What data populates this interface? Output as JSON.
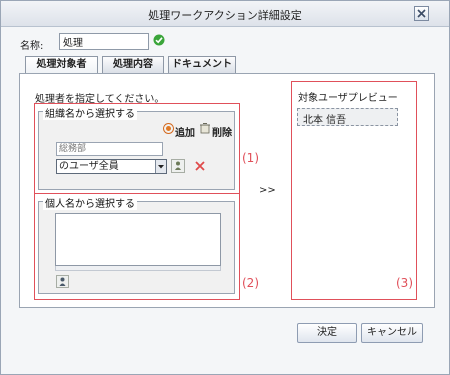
{
  "dialog": {
    "title": "処理ワークアクション詳細設定"
  },
  "name_field": {
    "label": "名称:",
    "value": "処理"
  },
  "tabs": [
    {
      "label": "処理対象者",
      "active": true
    },
    {
      "label": "処理内容",
      "active": false
    },
    {
      "label": "ドキュメント",
      "active": false
    }
  ],
  "main": {
    "instruction": "処理者を指定してください。",
    "org_section": {
      "legend": "組織名から選択する",
      "add_label": "追加",
      "delete_label": "削除",
      "dept_placeholder": "総務部",
      "selected_user": "のユーザ全員"
    },
    "person_section": {
      "legend": "個人名から選択する"
    },
    "transfer_arrow": ">>",
    "preview": {
      "title": "対象ユーザプレビュー",
      "users": [
        "北本 信吾"
      ]
    },
    "markers": [
      "(1)",
      "(2)",
      "(3)"
    ]
  },
  "buttons": {
    "ok": "決定",
    "cancel": "キャンセル"
  },
  "colors": {
    "highlight_border": "#e0505a",
    "accent_check": "#3aa53a"
  },
  "icons": [
    "close-icon",
    "check-icon",
    "add-icon",
    "delete-icon",
    "org-tree-icon",
    "clear-icon",
    "person-picker-icon"
  ]
}
